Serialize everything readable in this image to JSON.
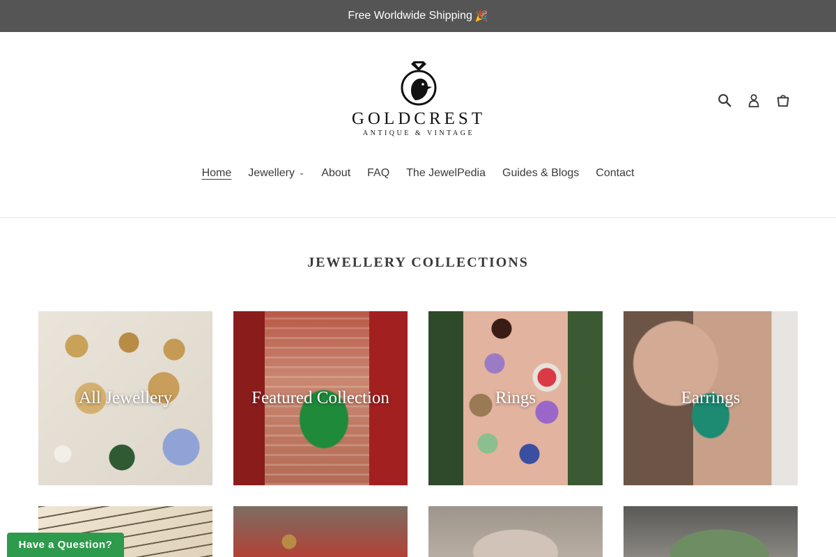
{
  "announcement": {
    "text": "Free Worldwide Shipping",
    "emoji": "🎉"
  },
  "brand": {
    "name": "GOLDCREST",
    "tagline": "ANTIQUE & VINTAGE"
  },
  "header_icons": [
    "search-icon",
    "account-icon",
    "cart-icon"
  ],
  "nav": {
    "items": [
      {
        "label": "Home",
        "active": true
      },
      {
        "label": "Jewellery",
        "has_dropdown": true
      },
      {
        "label": "About"
      },
      {
        "label": "FAQ"
      },
      {
        "label": "The JewelPedia"
      },
      {
        "label": "Guides & Blogs"
      },
      {
        "label": "Contact"
      }
    ]
  },
  "section": {
    "title": "JEWELLERY COLLECTIONS"
  },
  "collections": [
    {
      "label": "All Jewellery"
    },
    {
      "label": "Featured Collection"
    },
    {
      "label": "Rings"
    },
    {
      "label": "Earrings"
    },
    {
      "label": ""
    },
    {
      "label": ""
    },
    {
      "label": ""
    },
    {
      "label": ""
    }
  ],
  "help_widget": {
    "label": "Have a Question?"
  },
  "colors": {
    "announcement_bar": "#555555",
    "help_button": "#2e9a4c",
    "text": "#3a3a3a"
  }
}
